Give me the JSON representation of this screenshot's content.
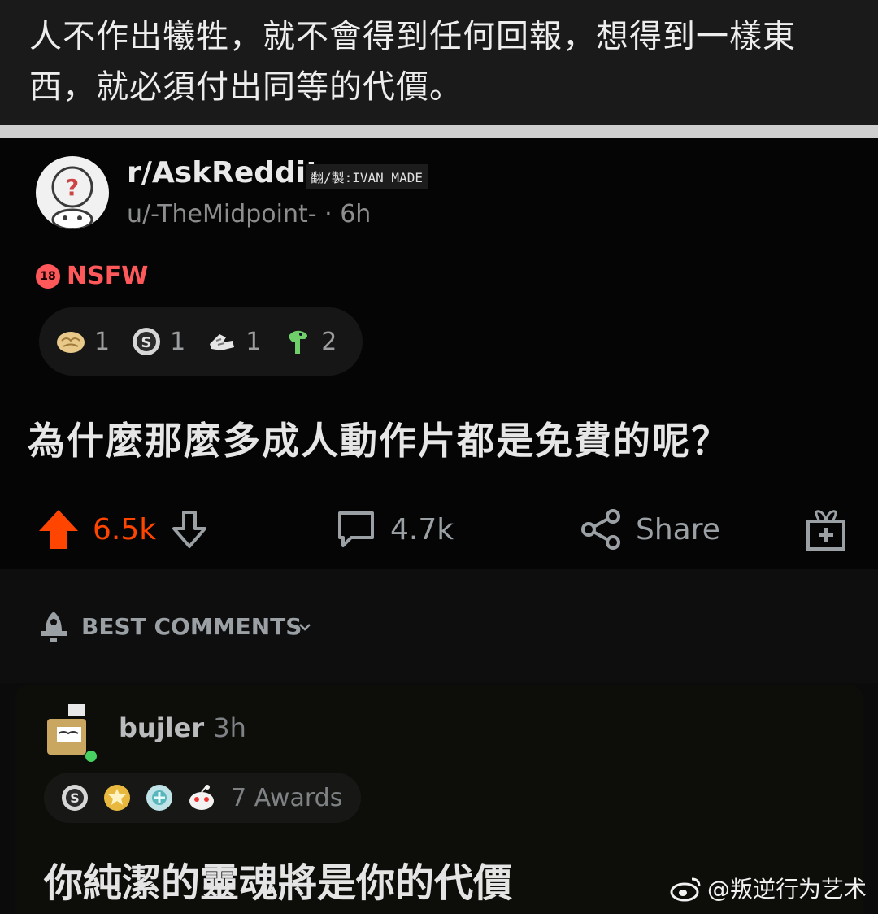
{
  "caption": {
    "line1": "人不作出犧牲，就不會得到任何回報，想得到一樣東",
    "line2": "西，就必須付出同等的代價。"
  },
  "post": {
    "subreddit": "r/AskReddit",
    "credit": "翻/製:IVAN MADE",
    "user": "u/-TheMidpoint-",
    "time": "· 6h",
    "nsfw_badge": "18",
    "nsfw_label": "NSFW",
    "awards": [
      {
        "icon": "brain-icon",
        "count": "1"
      },
      {
        "icon": "silver-coin-icon",
        "count": "1"
      },
      {
        "icon": "fist-bump-icon",
        "count": "1"
      },
      {
        "icon": "green-dino-icon",
        "count": "2"
      }
    ],
    "title": "為什麼那麼多成人動作片都是免費的呢？",
    "score": "6.5k",
    "comments": "4.7k",
    "share_label": "Share"
  },
  "comments_section": {
    "sort_label": "BEST COMMENTS"
  },
  "comment": {
    "author": "bujler",
    "time": "3h",
    "awards_text": "7 Awards",
    "body": "你純潔的靈魂將是你的代價"
  },
  "watermark": {
    "text": "@叛逆行为艺术"
  },
  "colors": {
    "upvote": "#ff4500",
    "nsfw": "#ff585b",
    "background": "#050506"
  }
}
